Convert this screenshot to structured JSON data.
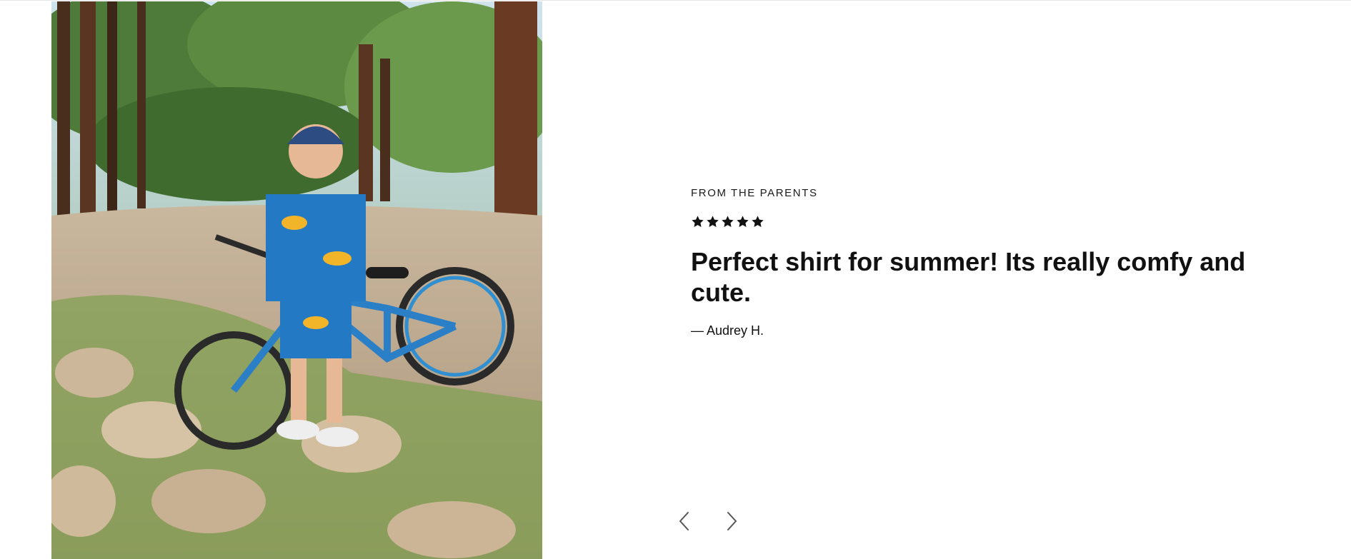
{
  "testimonial": {
    "eyebrow": "FROM THE PARENTS",
    "rating": 5,
    "rating_max": 5,
    "quote": "Perfect shirt for summer! Its really comfy and cute.",
    "author": "— Audrey H."
  },
  "photo": {
    "subject": "child-with-bicycle-in-forest"
  },
  "icons": {
    "star": "star-icon",
    "prev": "chevron-left-icon",
    "next": "chevron-right-icon"
  },
  "colors": {
    "text": "#111111",
    "star": "#111111",
    "arrow": "#555555"
  }
}
